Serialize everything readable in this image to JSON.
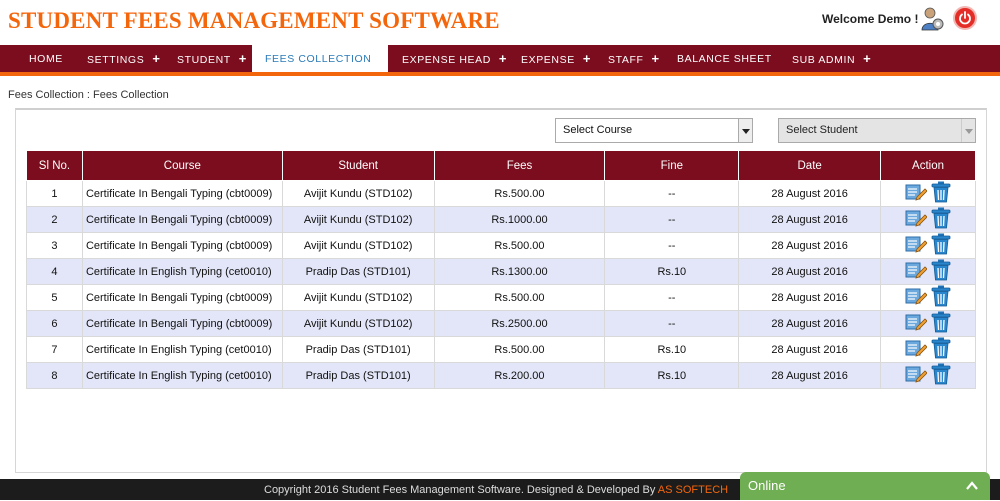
{
  "header": {
    "title": "STUDENT FEES MANAGEMENT SOFTWARE",
    "welcome": "Welcome Demo !"
  },
  "nav": {
    "items": [
      {
        "label": "HOME",
        "plus": ""
      },
      {
        "label": "SETTINGS",
        "plus": "+"
      },
      {
        "label": "STUDENT",
        "plus": "+"
      },
      {
        "label": "FEES COLLECTION",
        "plus": ""
      },
      {
        "label": "EXPENSE HEAD",
        "plus": "+"
      },
      {
        "label": "EXPENSE",
        "plus": "+"
      },
      {
        "label": "STAFF",
        "plus": "+"
      },
      {
        "label": "BALANCE SHEET",
        "plus": ""
      },
      {
        "label": "SUB ADMIN",
        "plus": "+"
      }
    ],
    "active": "FEES COLLECTION"
  },
  "breadcrumb": "Fees Collection : Fees Collection",
  "filters": {
    "course": "Select Course",
    "student": "Select Student"
  },
  "table": {
    "headers": [
      "Sl No.",
      "Course",
      "Student",
      "Fees",
      "Fine",
      "Date",
      "Action"
    ],
    "rows": [
      {
        "sl": "1",
        "course": "Certificate In Bengali Typing (cbt0009)",
        "student": "Avijit Kundu (STD102)",
        "fees": "Rs.500.00",
        "fine": "--",
        "date": "28 August 2016"
      },
      {
        "sl": "2",
        "course": "Certificate In Bengali Typing (cbt0009)",
        "student": "Avijit Kundu (STD102)",
        "fees": "Rs.1000.00",
        "fine": "--",
        "date": "28 August 2016"
      },
      {
        "sl": "3",
        "course": "Certificate In Bengali Typing (cbt0009)",
        "student": "Avijit Kundu (STD102)",
        "fees": "Rs.500.00",
        "fine": "--",
        "date": "28 August 2016"
      },
      {
        "sl": "4",
        "course": "Certificate In English Typing (cet0010)",
        "student": "Pradip Das (STD101)",
        "fees": "Rs.1300.00",
        "fine": "Rs.10",
        "date": "28 August 2016"
      },
      {
        "sl": "5",
        "course": "Certificate In Bengali Typing (cbt0009)",
        "student": "Avijit Kundu (STD102)",
        "fees": "Rs.500.00",
        "fine": "--",
        "date": "28 August 2016"
      },
      {
        "sl": "6",
        "course": "Certificate In Bengali Typing (cbt0009)",
        "student": "Avijit Kundu (STD102)",
        "fees": "Rs.2500.00",
        "fine": "--",
        "date": "28 August 2016"
      },
      {
        "sl": "7",
        "course": "Certificate In English Typing (cet0010)",
        "student": "Pradip Das (STD101)",
        "fees": "Rs.500.00",
        "fine": "Rs.10",
        "date": "28 August 2016"
      },
      {
        "sl": "8",
        "course": "Certificate In English Typing (cet0010)",
        "student": "Pradip Das (STD101)",
        "fees": "Rs.200.00",
        "fine": "Rs.10",
        "date": "28 August 2016"
      }
    ]
  },
  "footer": {
    "text": "Copyright 2016 Student Fees Management Software. Designed & Developed By ",
    "brand": "AS SOFTECH"
  },
  "chat": {
    "label": "Online"
  },
  "icons": {
    "user": "user-settings-icon",
    "power": "power-icon",
    "edit": "edit-icon",
    "delete": "trash-icon"
  },
  "colors": {
    "brand_orange": "#f4660c",
    "nav_maroon": "#7b0d1e",
    "row_stripe": "#e3e6f8",
    "online_green": "#6fae52"
  }
}
